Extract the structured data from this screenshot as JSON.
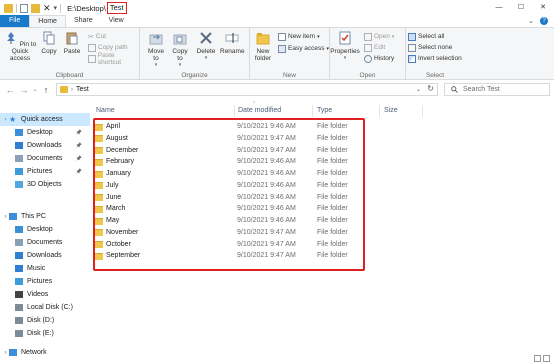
{
  "window": {
    "path_prefix": "E:\\Desktop\\",
    "path_current": "Test",
    "controls": [
      "—",
      "☐",
      "✕"
    ]
  },
  "ribbon_tabs": [
    "File",
    "Home",
    "Share",
    "View"
  ],
  "ribbon": {
    "clipboard": {
      "label": "Clipboard",
      "pin": "Pin to Quick access",
      "copy": "Copy",
      "paste": "Paste",
      "cut": "Cut",
      "copy_path": "Copy path",
      "paste_shortcut": "Paste shortcut"
    },
    "organize": {
      "label": "Organize",
      "move_to": "Move to",
      "copy_to": "Copy to",
      "delete": "Delete",
      "rename": "Rename"
    },
    "new": {
      "label": "New",
      "new_folder": "New folder",
      "new_item": "New item",
      "easy_access": "Easy access"
    },
    "open": {
      "label": "Open",
      "properties": "Properties",
      "open": "Open",
      "edit": "Edit",
      "history": "History"
    },
    "select": {
      "label": "Select",
      "select_all": "Select all",
      "select_none": "Select none",
      "invert": "Invert selection"
    }
  },
  "address": {
    "path": "Test",
    "search_placeholder": "Search Test"
  },
  "nav": [
    {
      "label": "Quick access",
      "icon": "star-icon",
      "selected": true,
      "pinned": false,
      "level": 0
    },
    {
      "label": "Desktop",
      "icon": "desktop-icon",
      "pinned": true,
      "level": 1
    },
    {
      "label": "Downloads",
      "icon": "download-icon",
      "pinned": true,
      "level": 1
    },
    {
      "label": "Documents",
      "icon": "documents-icon",
      "pinned": true,
      "level": 1
    },
    {
      "label": "Pictures",
      "icon": "pictures-icon",
      "pinned": true,
      "level": 1
    },
    {
      "label": "3D Objects",
      "icon": "3d-objects-icon",
      "pinned": false,
      "level": 1
    },
    {
      "label": "This PC",
      "icon": "pc-icon",
      "pinned": false,
      "level": 0
    },
    {
      "label": "Desktop",
      "icon": "desktop-icon",
      "pinned": false,
      "level": 1
    },
    {
      "label": "Documents",
      "icon": "documents-icon",
      "pinned": false,
      "level": 1
    },
    {
      "label": "Downloads",
      "icon": "download-icon",
      "pinned": false,
      "level": 1
    },
    {
      "label": "Music",
      "icon": "music-icon",
      "pinned": false,
      "level": 1
    },
    {
      "label": "Pictures",
      "icon": "pictures-icon",
      "pinned": false,
      "level": 1
    },
    {
      "label": "Videos",
      "icon": "videos-icon",
      "pinned": false,
      "level": 1
    },
    {
      "label": "Local Disk (C:)",
      "icon": "disk-icon",
      "pinned": false,
      "level": 1
    },
    {
      "label": "Disk (D:)",
      "icon": "disk-icon",
      "pinned": false,
      "level": 1
    },
    {
      "label": "Disk (E:)",
      "icon": "disk-icon",
      "pinned": false,
      "level": 1
    },
    {
      "label": "Network",
      "icon": "network-icon",
      "pinned": false,
      "level": 0
    }
  ],
  "columns": [
    "Name",
    "Date modified",
    "Type",
    "Size"
  ],
  "files": [
    {
      "name": "April",
      "date": "9/10/2021 9:46 AM",
      "type": "File folder"
    },
    {
      "name": "August",
      "date": "9/10/2021 9:47 AM",
      "type": "File folder"
    },
    {
      "name": "December",
      "date": "9/10/2021 9:47 AM",
      "type": "File folder"
    },
    {
      "name": "February",
      "date": "9/10/2021 9:46 AM",
      "type": "File folder"
    },
    {
      "name": "January",
      "date": "9/10/2021 9:46 AM",
      "type": "File folder"
    },
    {
      "name": "July",
      "date": "9/10/2021 9:46 AM",
      "type": "File folder"
    },
    {
      "name": "June",
      "date": "9/10/2021 9:46 AM",
      "type": "File folder"
    },
    {
      "name": "March",
      "date": "9/10/2021 9:46 AM",
      "type": "File folder"
    },
    {
      "name": "May",
      "date": "9/10/2021 9:46 AM",
      "type": "File folder"
    },
    {
      "name": "November",
      "date": "9/10/2021 9:47 AM",
      "type": "File folder"
    },
    {
      "name": "October",
      "date": "9/10/2021 9:47 AM",
      "type": "File folder"
    },
    {
      "name": "September",
      "date": "9/10/2021 9:47 AM",
      "type": "File folder"
    }
  ],
  "colors": {
    "accent": "#1979ca",
    "selection": "#cce8ff",
    "highlight": "#e02020",
    "folder": "#f0c64b"
  }
}
